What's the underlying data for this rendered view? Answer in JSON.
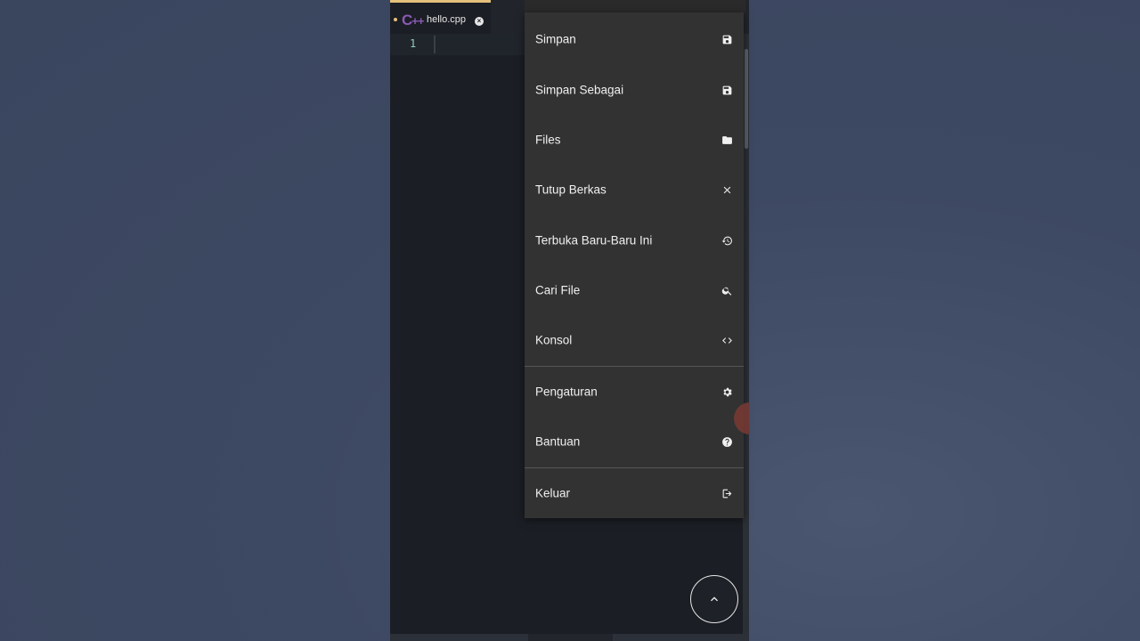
{
  "editor": {
    "tab": {
      "filename": "hello.cpp",
      "lang_icon": "c++-icon",
      "modified": true
    },
    "line_numbers": [
      "1"
    ]
  },
  "menu": {
    "items": [
      {
        "label": "Simpan",
        "icon": "save-icon"
      },
      {
        "label": "Simpan Sebagai",
        "icon": "save-as-icon"
      },
      {
        "label": "Files",
        "icon": "folder-icon"
      },
      {
        "label": "Tutup Berkas",
        "icon": "close-icon"
      },
      {
        "label": "Terbuka Baru-Baru Ini",
        "icon": "history-icon"
      },
      {
        "label": "Cari File",
        "icon": "search-icon"
      },
      {
        "label": "Konsol",
        "icon": "code-icon"
      },
      {
        "label": "Pengaturan",
        "icon": "gear-icon"
      },
      {
        "label": "Bantuan",
        "icon": "help-icon"
      },
      {
        "label": "Keluar",
        "icon": "logout-icon"
      }
    ]
  },
  "fab": {
    "icon": "chevron-up-icon"
  },
  "colors": {
    "tab_accent": "#e5c07b",
    "cpp_icon": "#8a5ab5",
    "menu_bg": "#323232",
    "editor_bg": "#1b1e24"
  }
}
